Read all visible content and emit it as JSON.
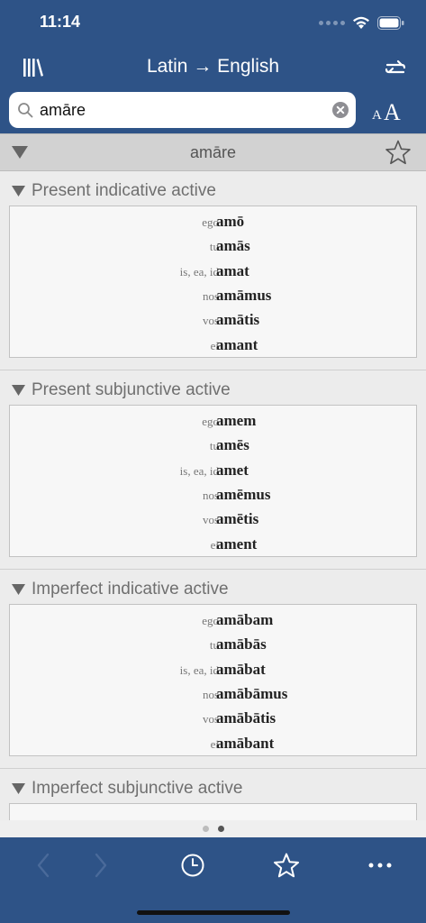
{
  "status": {
    "time": "11:14"
  },
  "header": {
    "title": "Latin → English"
  },
  "search": {
    "value": "amāre"
  },
  "font_size_button": {
    "small": "A",
    "big": "A"
  },
  "entry": {
    "word": "amāre"
  },
  "sections": [
    {
      "title": "Present indicative active",
      "rows": [
        {
          "pronoun": "ego",
          "form": "amō"
        },
        {
          "pronoun": "tu",
          "form": "amās"
        },
        {
          "pronoun": "is, ea, id",
          "form": "amat"
        },
        {
          "pronoun": "nos",
          "form": "amāmus"
        },
        {
          "pronoun": "vos",
          "form": "amātis"
        },
        {
          "pronoun": "ei",
          "form": "amant"
        }
      ]
    },
    {
      "title": "Present subjunctive active",
      "rows": [
        {
          "pronoun": "ego",
          "form": "amem"
        },
        {
          "pronoun": "tu",
          "form": "amēs"
        },
        {
          "pronoun": "is, ea, id",
          "form": "amet"
        },
        {
          "pronoun": "nos",
          "form": "amēmus"
        },
        {
          "pronoun": "vos",
          "form": "amētis"
        },
        {
          "pronoun": "ei",
          "form": "ament"
        }
      ]
    },
    {
      "title": "Imperfect indicative active",
      "rows": [
        {
          "pronoun": "ego",
          "form": "amābam"
        },
        {
          "pronoun": "tu",
          "form": "amābās"
        },
        {
          "pronoun": "is, ea, id",
          "form": "amābat"
        },
        {
          "pronoun": "nos",
          "form": "amābāmus"
        },
        {
          "pronoun": "vos",
          "form": "amābātis"
        },
        {
          "pronoun": "ei",
          "form": "amābant"
        }
      ]
    },
    {
      "title": "Imperfect subjunctive active",
      "rows": []
    }
  ],
  "page_indicator": {
    "count": 2,
    "active_index": 1
  },
  "colors": {
    "brand": "#2e5387",
    "tab_inactive": "#4a6a9a",
    "tab_active": "#ffffff"
  },
  "toolbar": {
    "icons": [
      "back-icon",
      "forward-icon",
      "history-icon",
      "favorites-icon",
      "more-icon"
    ]
  }
}
